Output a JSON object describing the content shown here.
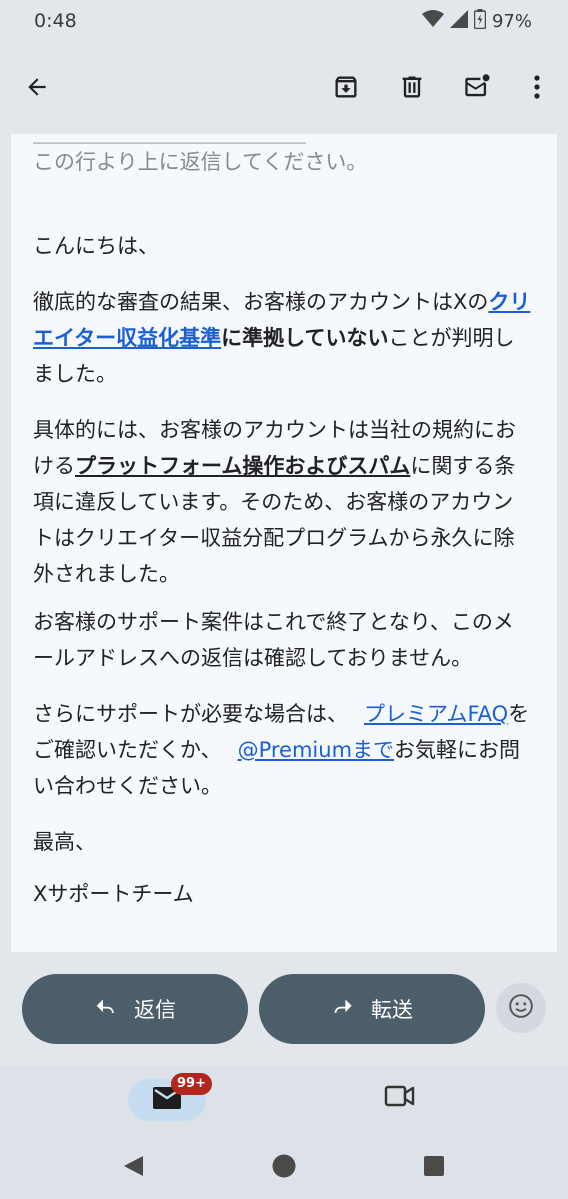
{
  "status_bar": {
    "time": "0:48",
    "battery": "97%"
  },
  "toolbar": {
    "icons": [
      "back-arrow-icon",
      "archive-icon",
      "delete-icon",
      "mark-unread-icon",
      "more-vert-icon"
    ]
  },
  "email": {
    "dash_line": "＿＿＿＿＿＿＿＿＿＿＿＿＿",
    "reply_above": "この行より上に返信してください。",
    "greeting": "こんにちは、",
    "p1_a": "徹底的な審査の結果、お客様のアカウントはXの",
    "p1_link": "クリエイター収益化基準",
    "p1_bold": "に準拠していない",
    "p1_b": "ことが判明しました。",
    "p2_a": "具体的には、お客様のアカウントは当社の規約における",
    "p2_bold": "プラットフォーム操作およびスパム",
    "p2_b": "に関する条項に違反しています。そのため、お客様のアカウントはクリエイター収益分配プログラムから永久に除外されました。",
    "p3": "お客様のサポート案件はこれで終了となり、このメールアドレスへの返信は確認しておりません。",
    "p4_a": "さらにサポートが必要な場合は、",
    "p4_link1": "プレミアムFAQ",
    "p4_b": "をご確認いただくか、",
    "p4_link2": "@Premiumまで",
    "p4_c": "お気軽にお問い合わせください。",
    "closing": "最高、",
    "signature": "Xサポートチーム"
  },
  "actions": {
    "reply_label": "返信",
    "forward_label": "転送"
  },
  "bottom_nav": {
    "badge": "99+"
  },
  "colors": {
    "accent_link": "#1a5fd6",
    "button_bg": "#4c5e6a",
    "badge_bg": "#b3261e"
  }
}
